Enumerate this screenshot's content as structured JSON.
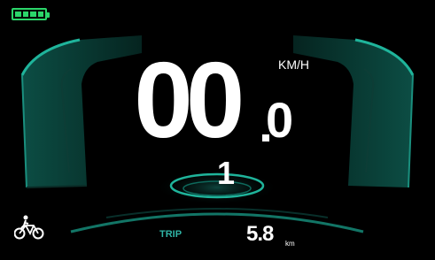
{
  "speed": {
    "integer": "00",
    "decimal": "0",
    "unit": "KM/H"
  },
  "gear": "1",
  "trip": {
    "label": "TRIP",
    "value": "5.8",
    "unit": "km"
  },
  "battery": {
    "level": 1.0,
    "segments": 4,
    "color": "#2bd56a"
  },
  "icons": {
    "battery": "battery-icon",
    "assist": "walk-assist-bicycle-icon"
  },
  "colors": {
    "accent": "#2fb3a5",
    "background": "#000000"
  }
}
